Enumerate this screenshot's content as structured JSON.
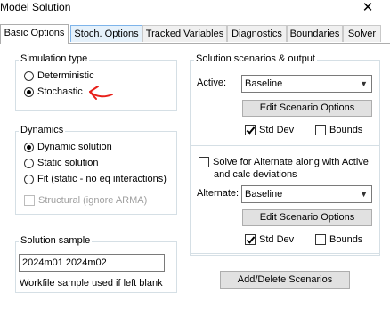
{
  "window": {
    "title": "Model Solution",
    "close_glyph": "✕"
  },
  "tabs": [
    {
      "label": "Basic Options",
      "active": true
    },
    {
      "label": "Stoch. Options"
    },
    {
      "label": "Tracked Variables"
    },
    {
      "label": "Diagnostics"
    },
    {
      "label": "Boundaries"
    },
    {
      "label": "Solver"
    }
  ],
  "simulation_type": {
    "title": "Simulation type",
    "options": [
      "Deterministic",
      "Stochastic"
    ],
    "selected": "Stochastic"
  },
  "dynamics": {
    "title": "Dynamics",
    "options": [
      "Dynamic solution",
      "Static solution",
      "Fit (static - no eq interactions)"
    ],
    "selected": "Dynamic solution",
    "structural_label": "Structural (ignore ARMA)"
  },
  "solution_sample": {
    "title": "Solution sample",
    "value": "2024m01 2024m02",
    "hint": "Workfile sample used if left blank"
  },
  "scenarios": {
    "title": "Solution scenarios & output",
    "active_label": "Active:",
    "active_value": "Baseline",
    "edit_button": "Edit Scenario Options",
    "std_dev_label": "Std Dev",
    "bounds_label": "Bounds",
    "solve_alt_label": "Solve for Alternate along with Active",
    "solve_alt_label2": "and calc deviations",
    "alternate_label": "Alternate:",
    "alternate_value": "Baseline",
    "edit_button_2": "Edit Scenario Options",
    "std_dev_label_2": "Std Dev",
    "bounds_label_2": "Bounds",
    "add_delete_button": "Add/Delete Scenarios"
  },
  "annotation_color": "#e8201a"
}
